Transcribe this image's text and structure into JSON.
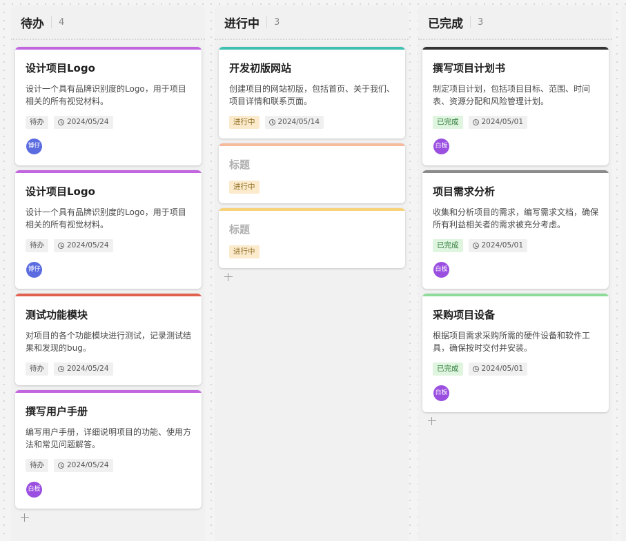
{
  "columns": [
    {
      "title": "待办",
      "count": "4",
      "cards": [
        {
          "title": "设计项目Logo",
          "desc": "设计一个具有品牌识别度的Logo，用于项目相关的所有视觉材料。",
          "status": "待办",
          "date": "2024/05/24",
          "avatar": "博仔",
          "bar_color": "#c266e0",
          "avatar_color": "#5b6be0"
        },
        {
          "title": "设计项目Logo",
          "desc": "设计一个具有品牌识别度的Logo，用于项目相关的所有视觉材料。",
          "status": "待办",
          "date": "2024/05/24",
          "avatar": "博仔",
          "bar_color": "#c266e0",
          "avatar_color": "#5b6be0"
        },
        {
          "title": "测试功能模块",
          "desc": "对项目的各个功能模块进行测试，记录测试结果和发现的bug。",
          "status": "待办",
          "date": "2024/05/24",
          "avatar": "",
          "bar_color": "#e0624e",
          "avatar_color": ""
        },
        {
          "title": "撰写用户手册",
          "desc": "编写用户手册，详细说明项目的功能、使用方法和常见问题解答。",
          "status": "待办",
          "date": "2024/05/24",
          "avatar": "白板",
          "bar_color": "#c266e0",
          "avatar_color": "#9a4fe0"
        }
      ]
    },
    {
      "title": "进行中",
      "count": "3",
      "cards": [
        {
          "title": "开发初版网站",
          "desc": "创建项目的网站初版，包括首页、关于我们、项目详情和联系页面。",
          "status": "进行中",
          "date": "2024/05/14",
          "avatar": "",
          "bar_color": "#3fbfb0",
          "avatar_color": ""
        },
        {
          "title": "标题",
          "desc": "",
          "status": "进行中",
          "date": "",
          "avatar": "",
          "bar_color": "#f5b99b",
          "avatar_color": "",
          "placeholder": true
        },
        {
          "title": "标题",
          "desc": "",
          "status": "进行中",
          "date": "",
          "avatar": "",
          "bar_color": "#f8d27a",
          "avatar_color": "",
          "placeholder": true
        }
      ]
    },
    {
      "title": "已完成",
      "count": "3",
      "cards": [
        {
          "title": "撰写项目计划书",
          "desc": "制定项目计划，包括项目目标、范围、时间表、资源分配和风险管理计划。",
          "status": "已完成",
          "date": "2024/05/01",
          "avatar": "白板",
          "bar_color": "#333333",
          "avatar_color": "#9a4fe0"
        },
        {
          "title": "项目需求分析",
          "desc": "收集和分析项目的需求，编写需求文档，确保所有利益相关者的需求被充分考虑。",
          "status": "已完成",
          "date": "2024/05/01",
          "avatar": "白板",
          "bar_color": "#8a8a8a",
          "avatar_color": "#9a4fe0"
        },
        {
          "title": "采购项目设备",
          "desc": "根据项目需求采购所需的硬件设备和软件工具，确保按时交付并安装。",
          "status": "已完成",
          "date": "2024/05/01",
          "avatar": "白板",
          "bar_color": "#8fdc9a",
          "avatar_color": "#9a4fe0"
        }
      ]
    }
  ]
}
